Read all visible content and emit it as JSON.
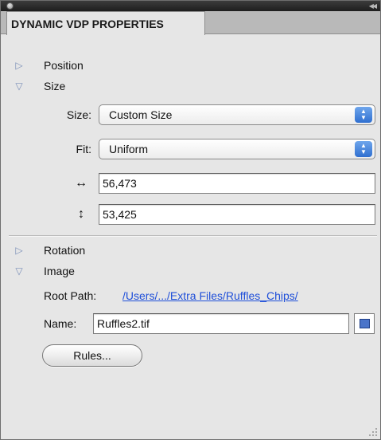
{
  "panel": {
    "tab_title": "DYNAMIC VDP PROPERTIES"
  },
  "sections": {
    "position": "Position",
    "size": "Size",
    "rotation": "Rotation",
    "image": "Image"
  },
  "size_section": {
    "size_label": "Size:",
    "size_value": "Custom Size",
    "fit_label": "Fit:",
    "fit_value": "Uniform",
    "width_value": "56,473",
    "height_value": "53,425"
  },
  "image_section": {
    "root_path_label": "Root Path:",
    "root_path_value": "/Users/.../Extra Files/Ruffles_Chips/",
    "name_label": "Name:",
    "name_value": "Ruffles2.tif",
    "rules_button": "Rules..."
  },
  "icons": {
    "collapse": "collapse-panel-icon",
    "width": "horizontal-arrow-icon",
    "height": "vertical-arrow-icon",
    "swatch": "color-swatch-icon"
  },
  "colors": {
    "accent_blue": "#2f6fd0",
    "link_blue": "#1f4fd9",
    "panel_bg": "#e6e6e6",
    "titlebar_bg": "#1e1e1e"
  }
}
